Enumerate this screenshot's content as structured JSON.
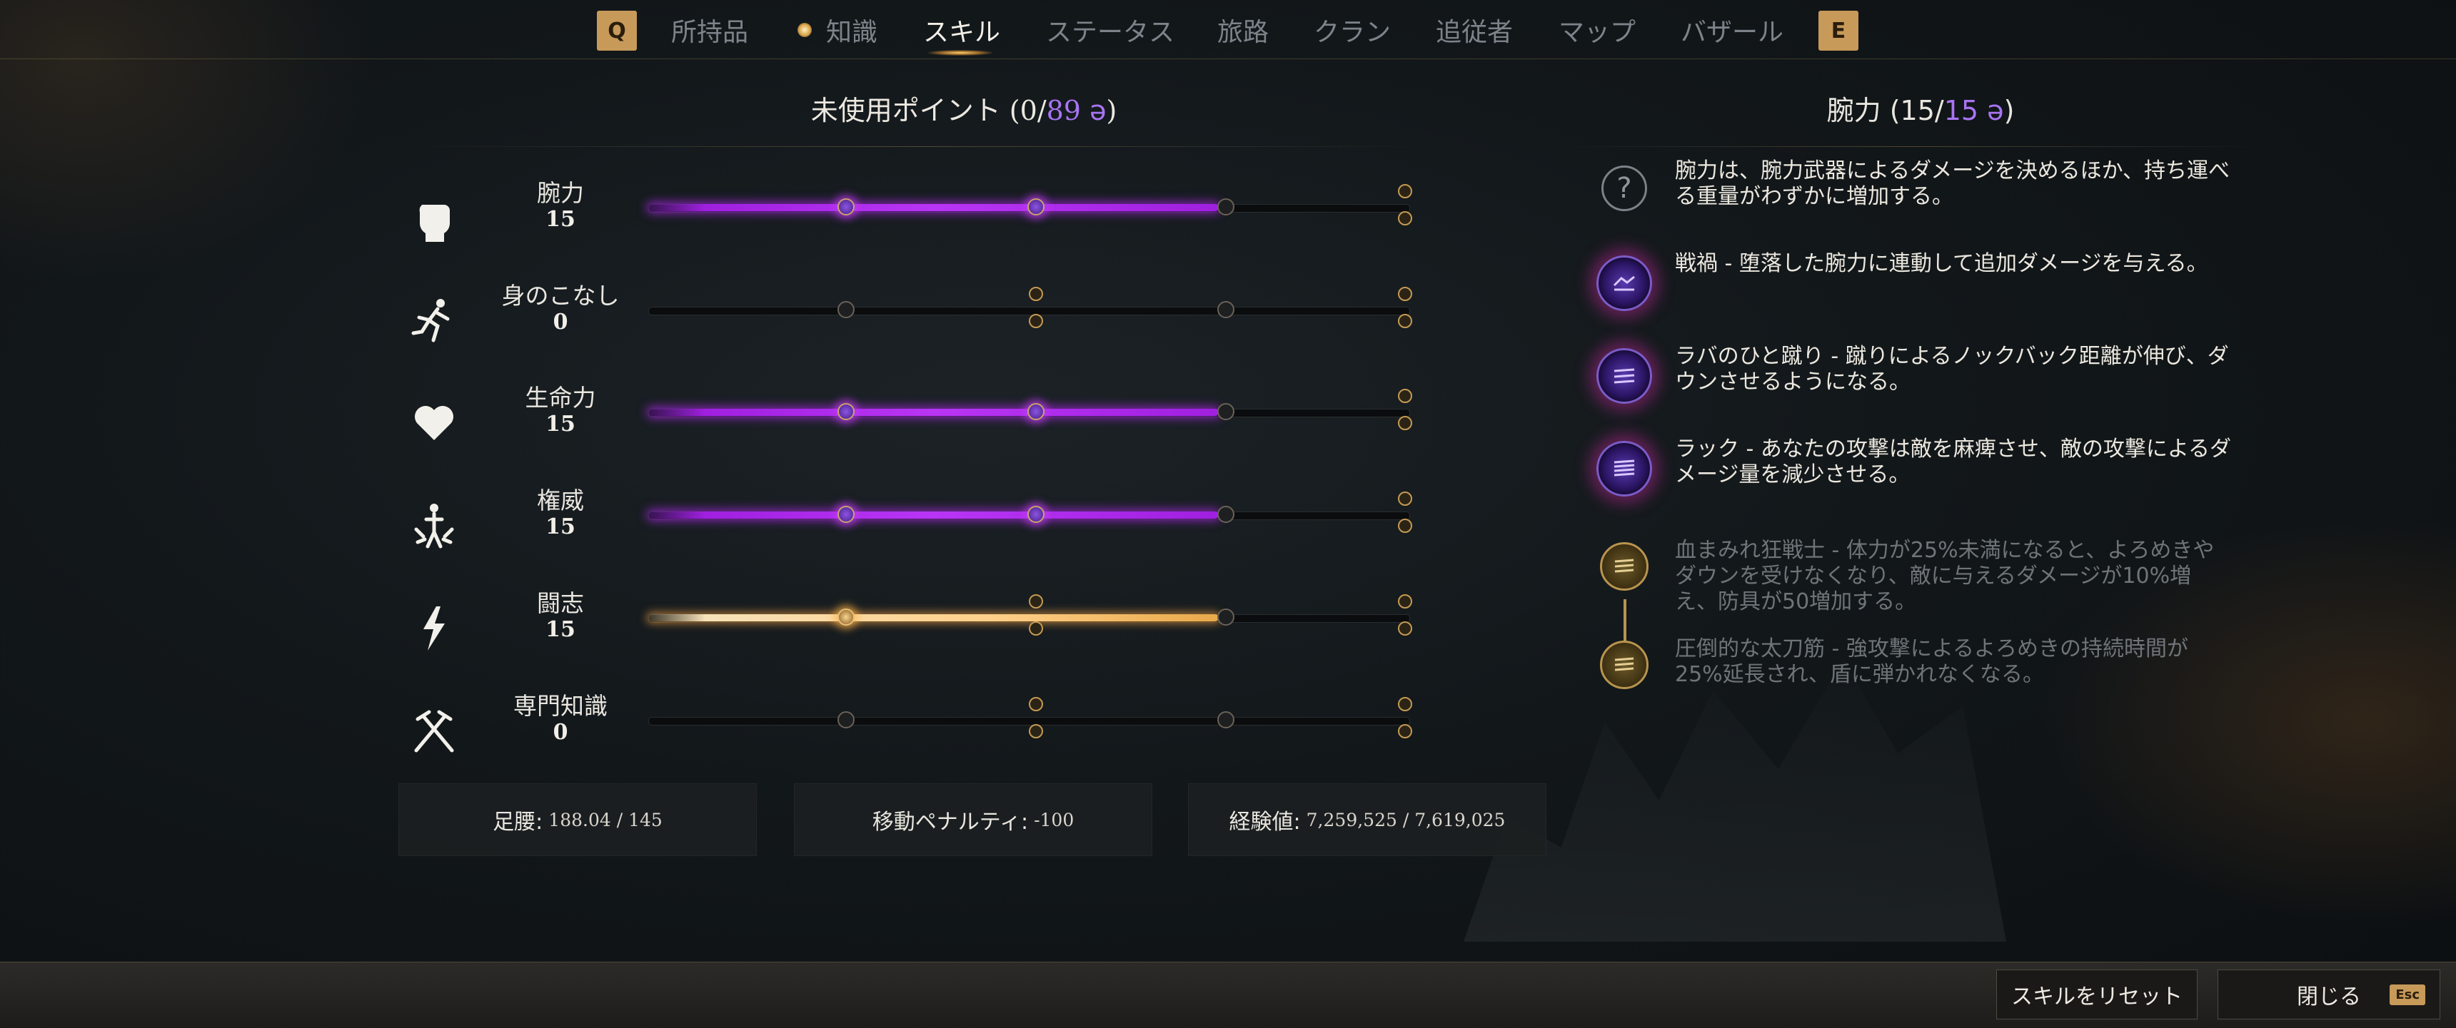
{
  "nav": {
    "left_key": "Q",
    "right_key": "E",
    "tabs": [
      "所持品",
      "知識",
      "スキル",
      "ステータス",
      "旅路",
      "クラン",
      "追従者",
      "マップ",
      "バザール"
    ],
    "active_tab": "スキル"
  },
  "points": {
    "label": "未使用ポイント",
    "open": "(",
    "used": "0",
    "sep": "/",
    "total": "89",
    "symbol": "ə",
    "close": ")"
  },
  "attributes": [
    {
      "name": "腕力",
      "value": "15",
      "icon": "fist-icon",
      "fill": 0.75,
      "fill_color": "purple"
    },
    {
      "name": "身のこなし",
      "value": "0",
      "icon": "running-figure-icon",
      "fill": 0.0,
      "fill_color": "none"
    },
    {
      "name": "生命力",
      "value": "15",
      "icon": "heart-icon",
      "fill": 0.75,
      "fill_color": "purple"
    },
    {
      "name": "権威",
      "value": "15",
      "icon": "authority-figure-icon",
      "fill": 0.75,
      "fill_color": "purple"
    },
    {
      "name": "闘志",
      "value": "15",
      "icon": "lightning-icon",
      "fill": 0.75,
      "fill_color": "gold"
    },
    {
      "name": "専門知識",
      "value": "0",
      "icon": "crossed-tools-icon",
      "fill": 0.0,
      "fill_color": "none"
    }
  ],
  "stats": {
    "load_label": "足腰:",
    "load_value": "188.04 / 145",
    "penalty_label": "移動ペナルティ:",
    "penalty_value": "-100",
    "xp_label": "経験値:",
    "xp_value": "7,259,525 / 7,619,025"
  },
  "detail": {
    "title_name": "腕力",
    "open": "(",
    "current": "15",
    "sep": "/",
    "max": "15",
    "symbol": "ə",
    "close": ")",
    "perks": [
      {
        "icon": "question-icon",
        "state": "info",
        "text": "腕力は、腕力武器によるダメージを決めるほか、持ち運べる重量がわずかに増加する。"
      },
      {
        "icon": "purple-rune-icon",
        "state": "active",
        "name": "戦禍",
        "text": "戦禍 - 堕落した腕力に連動して追加ダメージを与える。"
      },
      {
        "icon": "purple-rune-icon",
        "state": "active",
        "name": "ラバのひと蹴り",
        "text": "ラバのひと蹴り - 蹴りによるノックバック距離が伸び、ダウンさせるようになる。"
      },
      {
        "icon": "purple-rune-icon",
        "state": "active",
        "name": "ラック",
        "text": "ラック - あなたの攻撃は敵を麻痺させ、敵の攻撃によるダメージ量を減少させる。"
      },
      {
        "icon": "gold-rune-icon",
        "state": "locked",
        "name": "血まみれ狂戦士",
        "text": "血まみれ狂戦士 - 体力が25%未満になると、よろめきやダウンを受けなくなり、敵に与えるダメージが10%増え、防具が50増加する。"
      },
      {
        "icon": "gold-rune-icon",
        "state": "locked",
        "name": "圧倒的な太刀筋",
        "text": "圧倒的な太刀筋 - 強攻撃によるよろめきの持続時間が25%延長され、盾に弾かれなくなる。"
      }
    ]
  },
  "bottom": {
    "reset_label": "スキルをリセット",
    "close_label": "閉じる",
    "close_key": "Esc"
  },
  "colors": {
    "accent_purple": "#a874f2",
    "accent_gold": "#c79a5a"
  }
}
